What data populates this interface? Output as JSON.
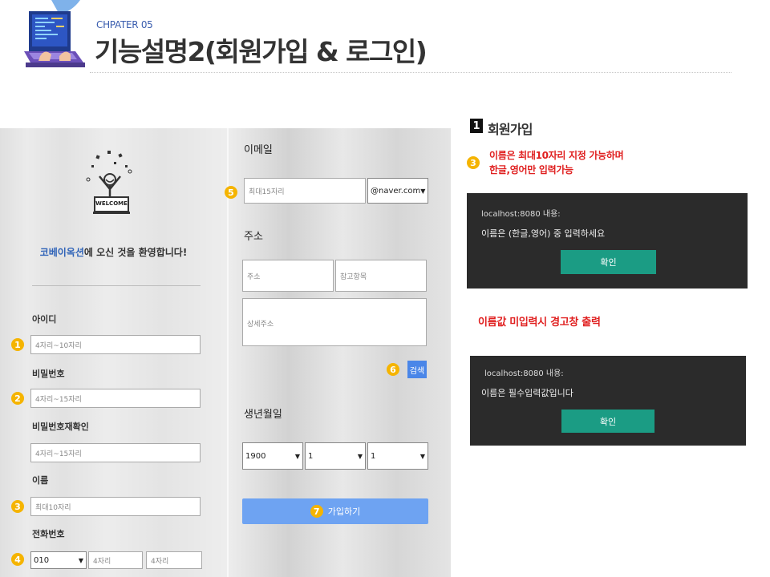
{
  "header": {
    "chapter": "CHPATER 05",
    "title": "기능설명2(회원가입 & 로그인)"
  },
  "form": {
    "welcome_highlight": "코베이옥션",
    "welcome_rest": "에 오신 것을 환영합니다!",
    "welcome_sign": "WELCOME",
    "id_label": "아이디",
    "id_placeholder": "4자리~10자리",
    "pw_label": "비밀번호",
    "pw_placeholder": "4자리~15자리",
    "pw_confirm_label": "비밀번호재확인",
    "pw_confirm_placeholder": "4자리~15자리",
    "name_label": "이름",
    "name_placeholder": "최대10자리",
    "phone_label": "전화번호",
    "phone_prefix": "010",
    "phone_mid_placeholder": "4자리",
    "phone_last_placeholder": "4자리",
    "email_label": "이메일",
    "email_placeholder": "최대15자리",
    "email_domain": "@naver.com",
    "address_label": "주소",
    "address_placeholder": "주소",
    "address_extra_placeholder": "참고항목",
    "address_detail_placeholder": "상세주소",
    "search_button": "검색",
    "birth_label": "생년월일",
    "birth_year": "1900",
    "birth_month": "1",
    "birth_day": "1",
    "join_button": "가입하기"
  },
  "markers": [
    "1",
    "2",
    "3",
    "4",
    "5",
    "6",
    "7"
  ],
  "right": {
    "section_number": "1",
    "section_title": "회원가입",
    "note_marker": "3",
    "note_line1": "이름은 최대10자리 지정 가능하며",
    "note_line2": "한글,영어만 입력가능",
    "dialog1_host": "localhost:8080 내용:",
    "dialog1_message": "이름은 (한글,영어) 중 입력하세요",
    "dialog1_button": "확인",
    "warning_text": "이름값 미입력시 경고창 출력",
    "dialog2_host": "localhost:8080 내용:",
    "dialog2_message": "이름은 필수입력값입니다",
    "dialog2_button": "확인"
  },
  "colors": {
    "marker": "#f5b400",
    "accent_blue": "#2f63b8",
    "join_button": "#6ea3f2",
    "dialog_bg": "#2b2b2b",
    "dialog_button": "#1b9c84",
    "red_text": "#e02020"
  }
}
